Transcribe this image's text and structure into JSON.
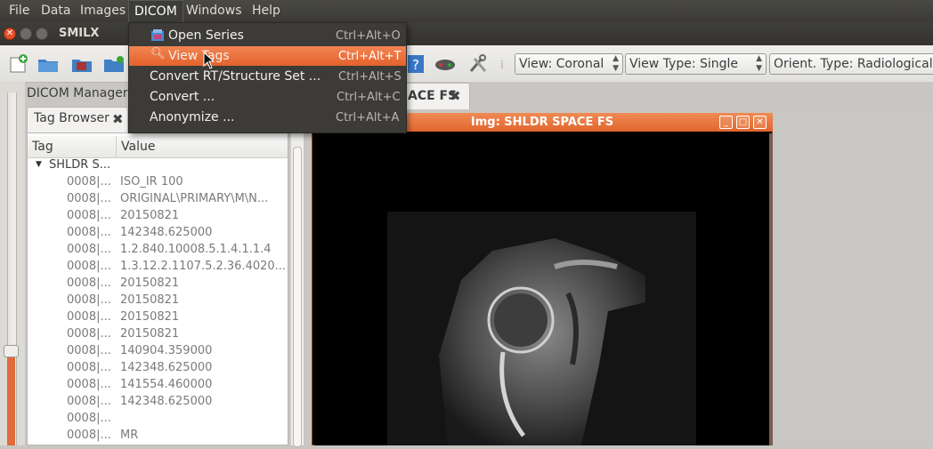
{
  "menubar": {
    "items": [
      "File",
      "Data",
      "Images",
      "DICOM",
      "Windows",
      "Help"
    ],
    "active": "DICOM"
  },
  "window": {
    "title": "SMILX"
  },
  "toolbar": {
    "view_combo": "View: Coronal",
    "view_type_combo": "View Type: Single",
    "orient_combo": "Orient. Type: Radiological"
  },
  "dicom_menu": {
    "items": [
      {
        "label": "Open Series",
        "shortcut": "Ctrl+Alt+O",
        "icon": "open-series-icon"
      },
      {
        "label": "View Tags",
        "shortcut": "Ctrl+Alt+T",
        "icon": "magnifier-icon",
        "highlighted": true
      },
      {
        "label": "Convert RT/Structure Set ...",
        "shortcut": "Ctrl+Alt+S"
      },
      {
        "label": "Convert ...",
        "shortcut": "Ctrl+Alt+C"
      },
      {
        "label": "Anonymize ...",
        "shortcut": "Ctrl+Alt+A"
      }
    ]
  },
  "dock": {
    "title": "DICOM Manager",
    "tab_label": "Tag Browser",
    "columns": [
      "Tag",
      "Value"
    ],
    "root": "SHLDR S...",
    "rows": [
      {
        "tag": "0008|...",
        "value": "ISO_IR 100"
      },
      {
        "tag": "0008|...",
        "value": "ORIGINAL\\PRIMARY\\M\\N..."
      },
      {
        "tag": "0008|...",
        "value": "20150821"
      },
      {
        "tag": "0008|...",
        "value": "142348.625000"
      },
      {
        "tag": "0008|...",
        "value": "1.2.840.10008.5.1.4.1.1.4"
      },
      {
        "tag": "0008|...",
        "value": "1.3.12.2.1107.5.2.36.4020..."
      },
      {
        "tag": "0008|...",
        "value": "20150821"
      },
      {
        "tag": "0008|...",
        "value": "20150821"
      },
      {
        "tag": "0008|...",
        "value": "20150821"
      },
      {
        "tag": "0008|...",
        "value": "20150821"
      },
      {
        "tag": "0008|...",
        "value": "140904.359000"
      },
      {
        "tag": "0008|...",
        "value": "142348.625000"
      },
      {
        "tag": "0008|...",
        "value": "141554.460000"
      },
      {
        "tag": "0008|...",
        "value": "142348.625000"
      },
      {
        "tag": "0008|...",
        "value": ""
      },
      {
        "tag": "0008|...",
        "value": "MR"
      }
    ]
  },
  "document_tab": {
    "label": "ACE FS"
  },
  "image_window": {
    "title": "Img: SHLDR SPACE FS"
  },
  "colors": {
    "accent": "#e4622c",
    "menu_bg": "#3c3b37"
  }
}
